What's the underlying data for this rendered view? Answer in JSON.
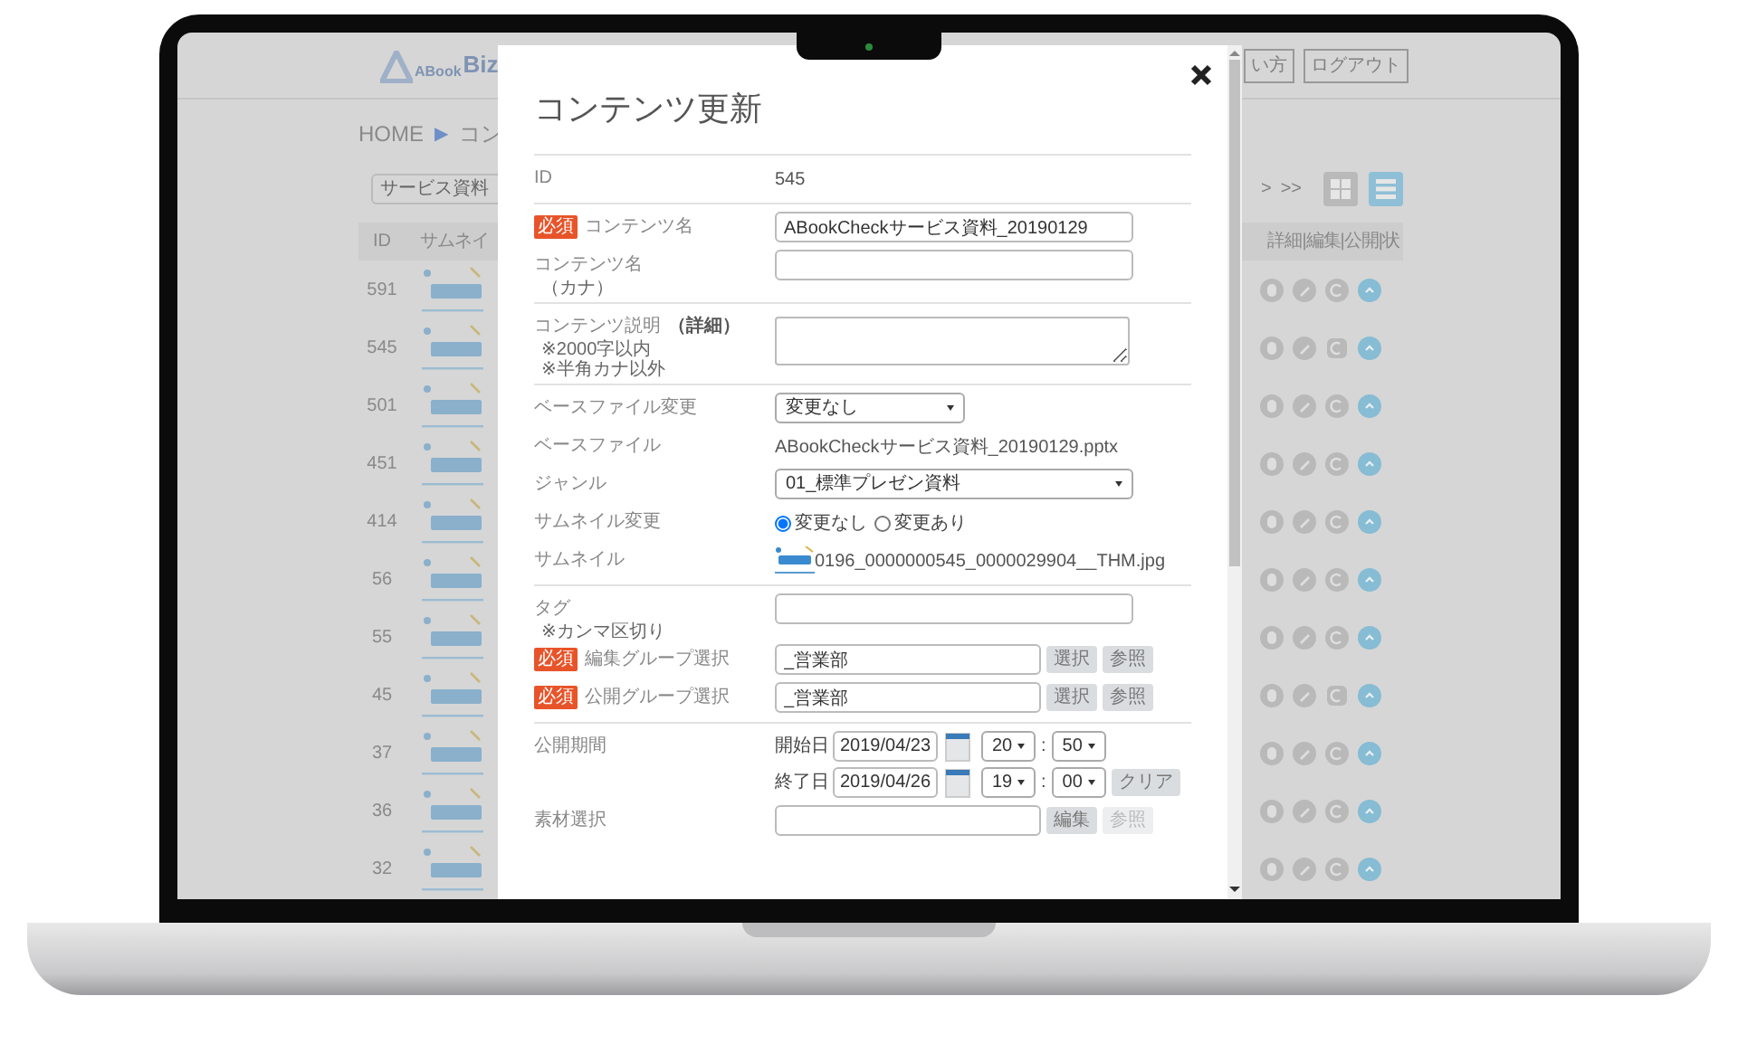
{
  "background_app": {
    "logo_mark": "ABook",
    "logo_text": "Biz",
    "header_buttons": [
      "い方",
      "ログアウト"
    ],
    "breadcrumb": [
      {
        "kind": "link",
        "text": "HOME"
      },
      {
        "kind": "separator",
        "text": "▶"
      },
      {
        "kind": "current",
        "text": "コン"
      }
    ],
    "search": {
      "value": "サービス資料"
    },
    "pager": [
      ">",
      ">>"
    ],
    "view_toggle": [
      {
        "kind": "grid",
        "selected": false
      },
      {
        "kind": "list",
        "selected": true
      }
    ],
    "table": {
      "columns": [
        "ID",
        "サムネイ",
        "詳細|編集|公開|状"
      ],
      "rows": [
        {
          "id": "591",
          "kind": "circle"
        },
        {
          "id": "545",
          "kind": "page"
        },
        {
          "id": "501",
          "kind": "circle"
        },
        {
          "id": "451",
          "kind": "circle"
        },
        {
          "id": "414",
          "kind": "circle"
        },
        {
          "id": "56",
          "kind": "circle"
        },
        {
          "id": "55",
          "kind": "circle"
        },
        {
          "id": "45",
          "kind": "page"
        },
        {
          "id": "37",
          "kind": "circle"
        },
        {
          "id": "36",
          "kind": "circle"
        },
        {
          "id": "32",
          "kind": "circle"
        }
      ]
    }
  },
  "modal": {
    "title": "コンテンツ更新",
    "groups": [
      [
        {
          "kind": "static",
          "label": "ID",
          "value": "545"
        }
      ],
      [
        {
          "kind": "input",
          "required_badge": "必須",
          "label": "コンテンツ名",
          "value": "ABookCheckサービス資料_20190129"
        },
        {
          "kind": "input",
          "label": "コンテンツ名",
          "notes": [
            "（カナ）"
          ]
        }
      ],
      [
        {
          "kind": "textarea",
          "label": "コンテンツ説明",
          "label_suffix": "（詳細）",
          "notes": [
            "※2000字以内",
            "※半角カナ以外"
          ]
        }
      ],
      [
        {
          "kind": "short_select",
          "label": "ベースファイル変更",
          "value": "変更なし"
        },
        {
          "kind": "static",
          "label": "ベースファイル",
          "value": "ABookCheckサービス資料_20190129.pptx"
        },
        {
          "kind": "select",
          "label": "ジャンル",
          "value": "01_標準プレゼン資料"
        },
        {
          "kind": "radio",
          "label": "サムネイル変更",
          "options": [
            {
              "label": "変更なし",
              "selected": true
            },
            {
              "label": "変更あり",
              "selected": false
            }
          ]
        },
        {
          "kind": "thumbnail",
          "label": "サムネイル",
          "value": "0196_0000000545_0000029904__THM.jpg"
        }
      ],
      [
        {
          "kind": "input",
          "label": "タグ",
          "notes": [
            "※カンマ区切り"
          ]
        },
        {
          "kind": "picker",
          "required_badge": "必須",
          "label": "編集グループ選択",
          "value": "_営業部",
          "buttons": [
            {
              "label": "選択",
              "disabled": false
            },
            {
              "label": "参照",
              "disabled": false
            }
          ]
        },
        {
          "kind": "picker",
          "required_badge": "必須",
          "label": "公開グループ選択",
          "value": "_営業部",
          "buttons": [
            {
              "label": "選択",
              "disabled": false
            },
            {
              "label": "参照",
              "disabled": false
            }
          ]
        }
      ],
      [
        {
          "kind": "period",
          "label": "公開期間",
          "ranges": [
            {
              "label": "開始日",
              "date": "2019/04/23",
              "hour": "20",
              "separator": ":",
              "minute": "50"
            },
            {
              "label": "終了日",
              "date": "2019/04/26",
              "hour": "19",
              "separator": ":",
              "minute": "00",
              "button": "クリア"
            }
          ]
        },
        {
          "kind": "picker",
          "label": "素材選択",
          "buttons": [
            {
              "label": "編集",
              "disabled": false
            },
            {
              "label": "参照",
              "disabled": true
            }
          ]
        }
      ]
    ]
  }
}
